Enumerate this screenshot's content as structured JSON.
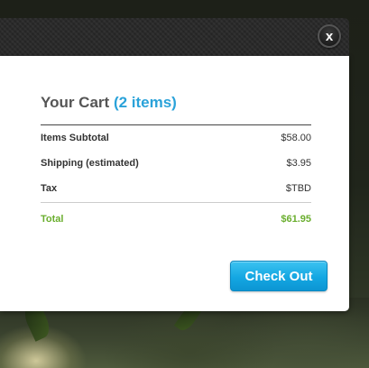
{
  "modal": {
    "close_label": "x"
  },
  "cart": {
    "title": "Your Cart",
    "item_count_label": "(2 items)",
    "rows": [
      {
        "label": "Items Subtotal",
        "value": "$58.00"
      },
      {
        "label": "Shipping (estimated)",
        "value": "$3.95"
      },
      {
        "label": "Tax",
        "value": "$TBD"
      }
    ],
    "total": {
      "label": "Total",
      "value": "$61.95"
    },
    "checkout_label": "Check Out"
  },
  "colors": {
    "accent_blue": "#2aa2d9",
    "total_green": "#6aae2e",
    "button_blue": "#14a7e2"
  }
}
